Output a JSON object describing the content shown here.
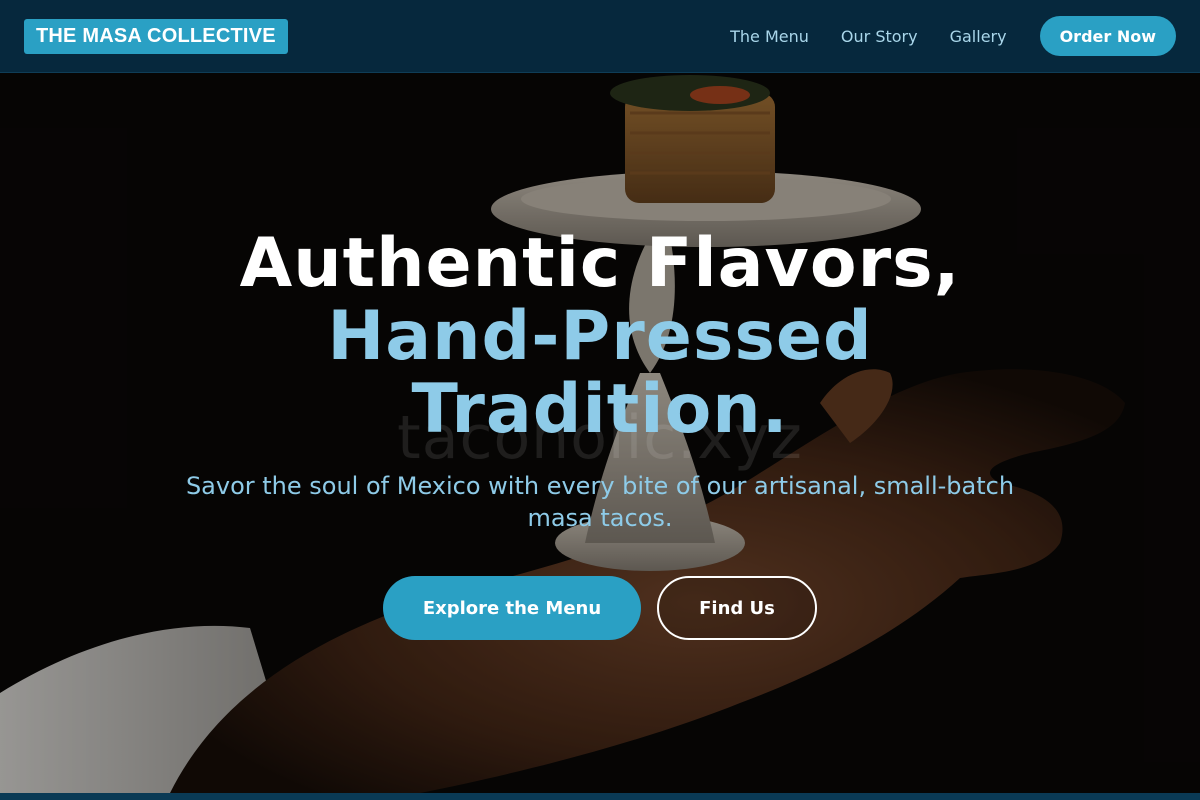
{
  "nav": {
    "logo": "THE MASA COLLECTIVE",
    "links": [
      "The Menu",
      "Our Story",
      "Gallery"
    ],
    "order_button": "Order Now"
  },
  "hero": {
    "headline_line1": "Authentic Flavors,",
    "headline_line2": "Hand-Pressed",
    "headline_line3": "Tradition.",
    "subtitle": "Savor the soul of Mexico with every bite of our artisanal, small-batch masa tacos.",
    "primary_cta": "Explore the Menu",
    "secondary_cta": "Find Us",
    "watermark": "tacoholic.xyz"
  },
  "colors": {
    "nav_background": "#06283d",
    "accent": "#2aa0c4",
    "accent_light": "#8ecbe8",
    "white": "#ffffff"
  }
}
